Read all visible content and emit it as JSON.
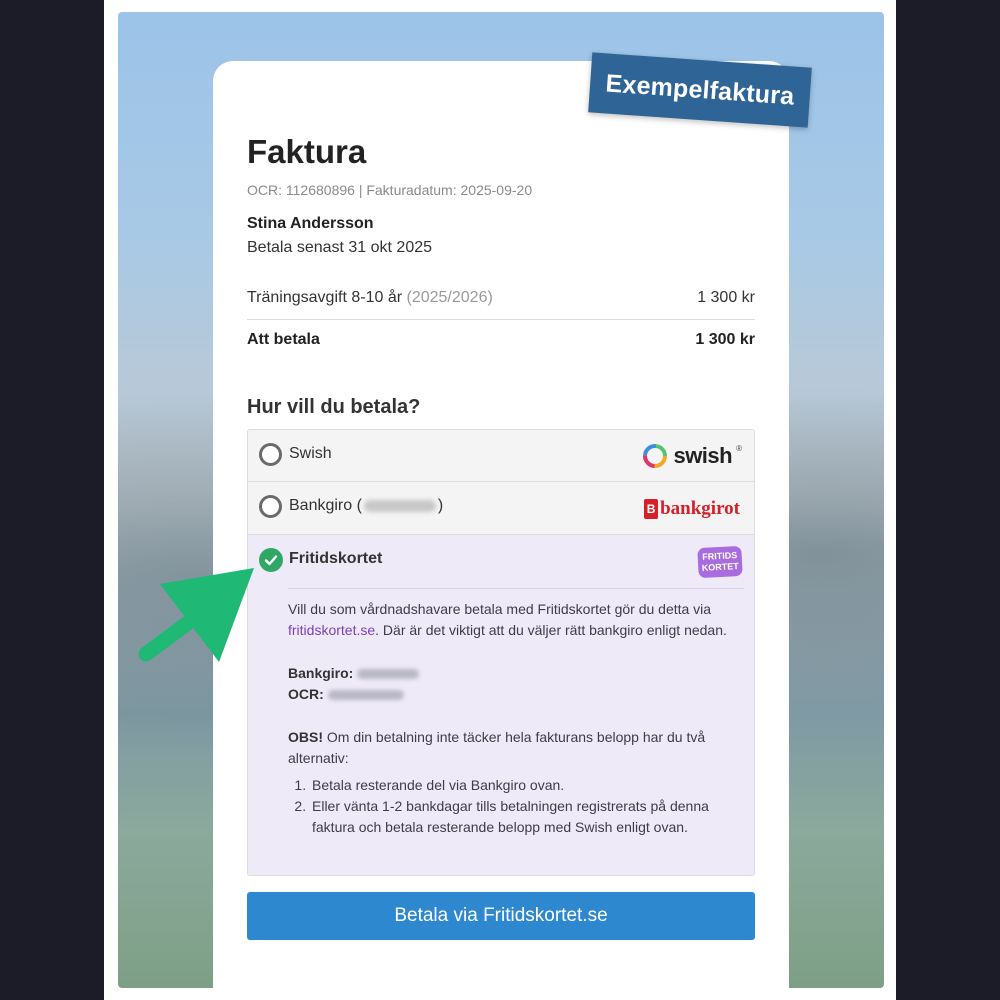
{
  "stamp": "Exempelfaktura",
  "invoice": {
    "title": "Faktura",
    "meta": "OCR: 112680896 | Fakturadatum: 2025-09-20",
    "customer_name": "Stina Andersson",
    "due": "Betala senast 31 okt 2025",
    "line_item": {
      "label": "Träningsavgift 8-10 år",
      "season": "(2025/2026)",
      "amount": "1 300 kr"
    },
    "total": {
      "label": "Att betala",
      "amount": "1 300 kr"
    }
  },
  "payment": {
    "heading": "Hur vill du betala?",
    "options": [
      {
        "label": "Swish",
        "logo_text": "swish",
        "logo_mark": "®",
        "selected": false
      },
      {
        "label_prefix": "Bankgiro (",
        "label_suffix": ")",
        "logo_text": "bankgirot",
        "logo_mark": "B",
        "selected": false
      },
      {
        "label": "Fritidskortet",
        "logo_line1": "FRITIDS",
        "logo_line2": "KORTET",
        "selected": true
      }
    ],
    "fritidskortet_info": {
      "intro_1": "Vill du som vårdnadshavare betala med Fritidskortet gör du detta via ",
      "link": "fritidskortet.se",
      "intro_2": ". Där är det viktigt att du väljer rätt bankgiro enligt nedan.",
      "bankgiro_label": "Bankgiro:",
      "ocr_label": "OCR:",
      "obs_label": "OBS!",
      "obs_text": " Om din betalning inte täcker hela fakturans belopp har du två alternativ:",
      "steps": [
        "Betala resterande del via Bankgiro ovan.",
        "Eller vänta 1-2 bankdagar tills betalningen registrerats på denna faktura och betala resterande belopp med Swish enligt ovan."
      ]
    },
    "pay_button": "Betala via Fritidskortet.se"
  },
  "colors": {
    "accent": "#2d88d0",
    "selected_bg": "#efeaf8",
    "check": "#2fa866",
    "arrow": "#1fb874",
    "stamp_bg": "#2f6496"
  },
  "icons": {
    "arrow": "arrow-pointing-icon",
    "check": "check-icon"
  }
}
